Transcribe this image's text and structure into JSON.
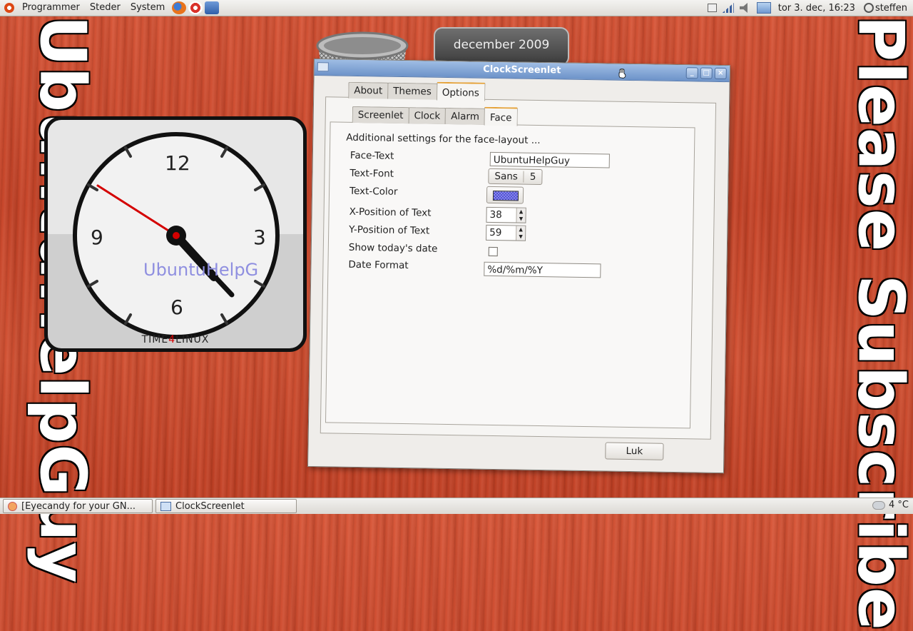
{
  "top_panel": {
    "menus": [
      "Programmer",
      "Steder",
      "System"
    ],
    "clock": "tor  3. dec, 16:23",
    "user": "steffen"
  },
  "bottom_panel": {
    "tasks": [
      "[Eyecandy for your GN...",
      "ClockScreenlet"
    ],
    "temperature": "4 °C"
  },
  "overlay": {
    "left_text": "UbuntuHelpGuy",
    "right_text": "Please Subscribe"
  },
  "calendar": {
    "label": "december 2009"
  },
  "clock_widget": {
    "numerals": {
      "twelve": "12",
      "three": "3",
      "six": "6",
      "nine": "9"
    },
    "brand_pre": "TIME",
    "brand_mid": "4",
    "brand_post": "LINUX",
    "face_text": "UbuntuHelpG"
  },
  "dialog": {
    "title": "ClockScreenlet",
    "tabs": [
      "About",
      "Themes",
      "Options"
    ],
    "active_tab": "Options",
    "subtabs": [
      "Screenlet",
      "Clock",
      "Alarm",
      "Face"
    ],
    "active_subtab": "Face",
    "description": "Additional settings for the face-layout ...",
    "labels": {
      "face_text": "Face-Text",
      "text_font": "Text-Font",
      "text_color": "Text-Color",
      "x_pos": "X-Position of Text",
      "y_pos": "Y-Position of Text",
      "show_date": "Show today's date",
      "date_format": "Date Format"
    },
    "values": {
      "face_text": "UbuntuHelpGuy",
      "font_name": "Sans",
      "font_size": "5",
      "x_pos": "38",
      "y_pos": "59",
      "date_format": "%d/%m/%Y"
    },
    "show_date_checked": false,
    "close_label": "Luk",
    "text_color": "#4b4bd6"
  }
}
